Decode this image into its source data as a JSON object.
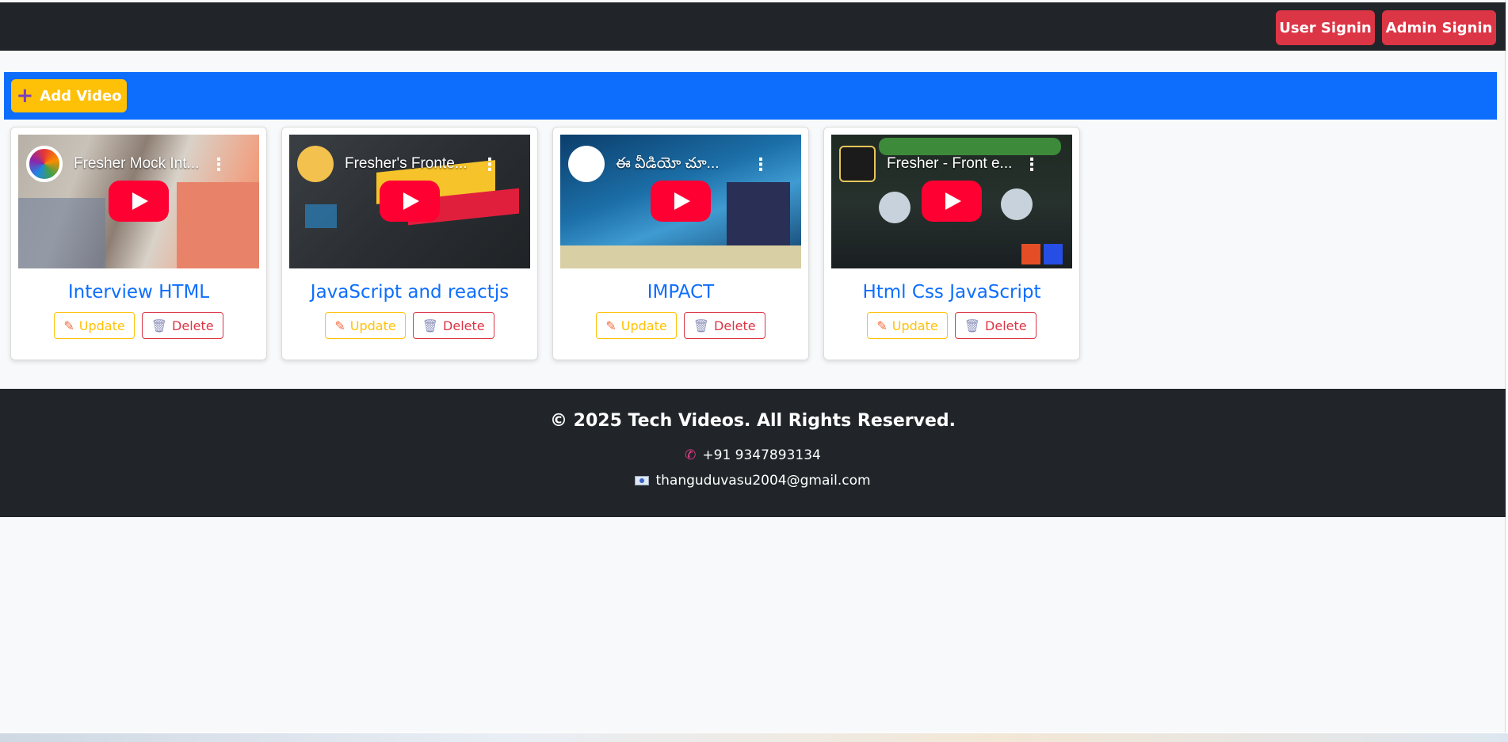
{
  "header": {
    "user_signin_label": "User Signin",
    "admin_signin_label": "Admin Signin"
  },
  "toolbar": {
    "add_video_label": "Add Video",
    "add_icon": "plus-icon"
  },
  "videos": [
    {
      "embed_title": "Fresher Mock Int...",
      "title": "Interview HTML",
      "update_label": "Update",
      "delete_label": "Delete"
    },
    {
      "embed_title": "Fresher's Fronte...",
      "title": "JavaScript and reactjs",
      "update_label": "Update",
      "delete_label": "Delete"
    },
    {
      "embed_title": "ఈ వీడియో చూ...",
      "title": "IMPACT",
      "update_label": "Update",
      "delete_label": "Delete"
    },
    {
      "embed_title": "Fresher - Front e...",
      "title": "Html Css JavaScript",
      "update_label": "Update",
      "delete_label": "Delete"
    }
  ],
  "footer": {
    "copyright": "© 2025 Tech Videos. All Rights Reserved.",
    "phone": "+91 9347893134",
    "email": "thanguduvasu2004@gmail.com"
  },
  "colors": {
    "navbar": "#212529",
    "signin_buttons": "#dc3545",
    "toolbar_bar": "#0d6efd",
    "add_button": "#ffc107",
    "card_title": "#0d6efd",
    "youtube_play": "#ff0033"
  }
}
